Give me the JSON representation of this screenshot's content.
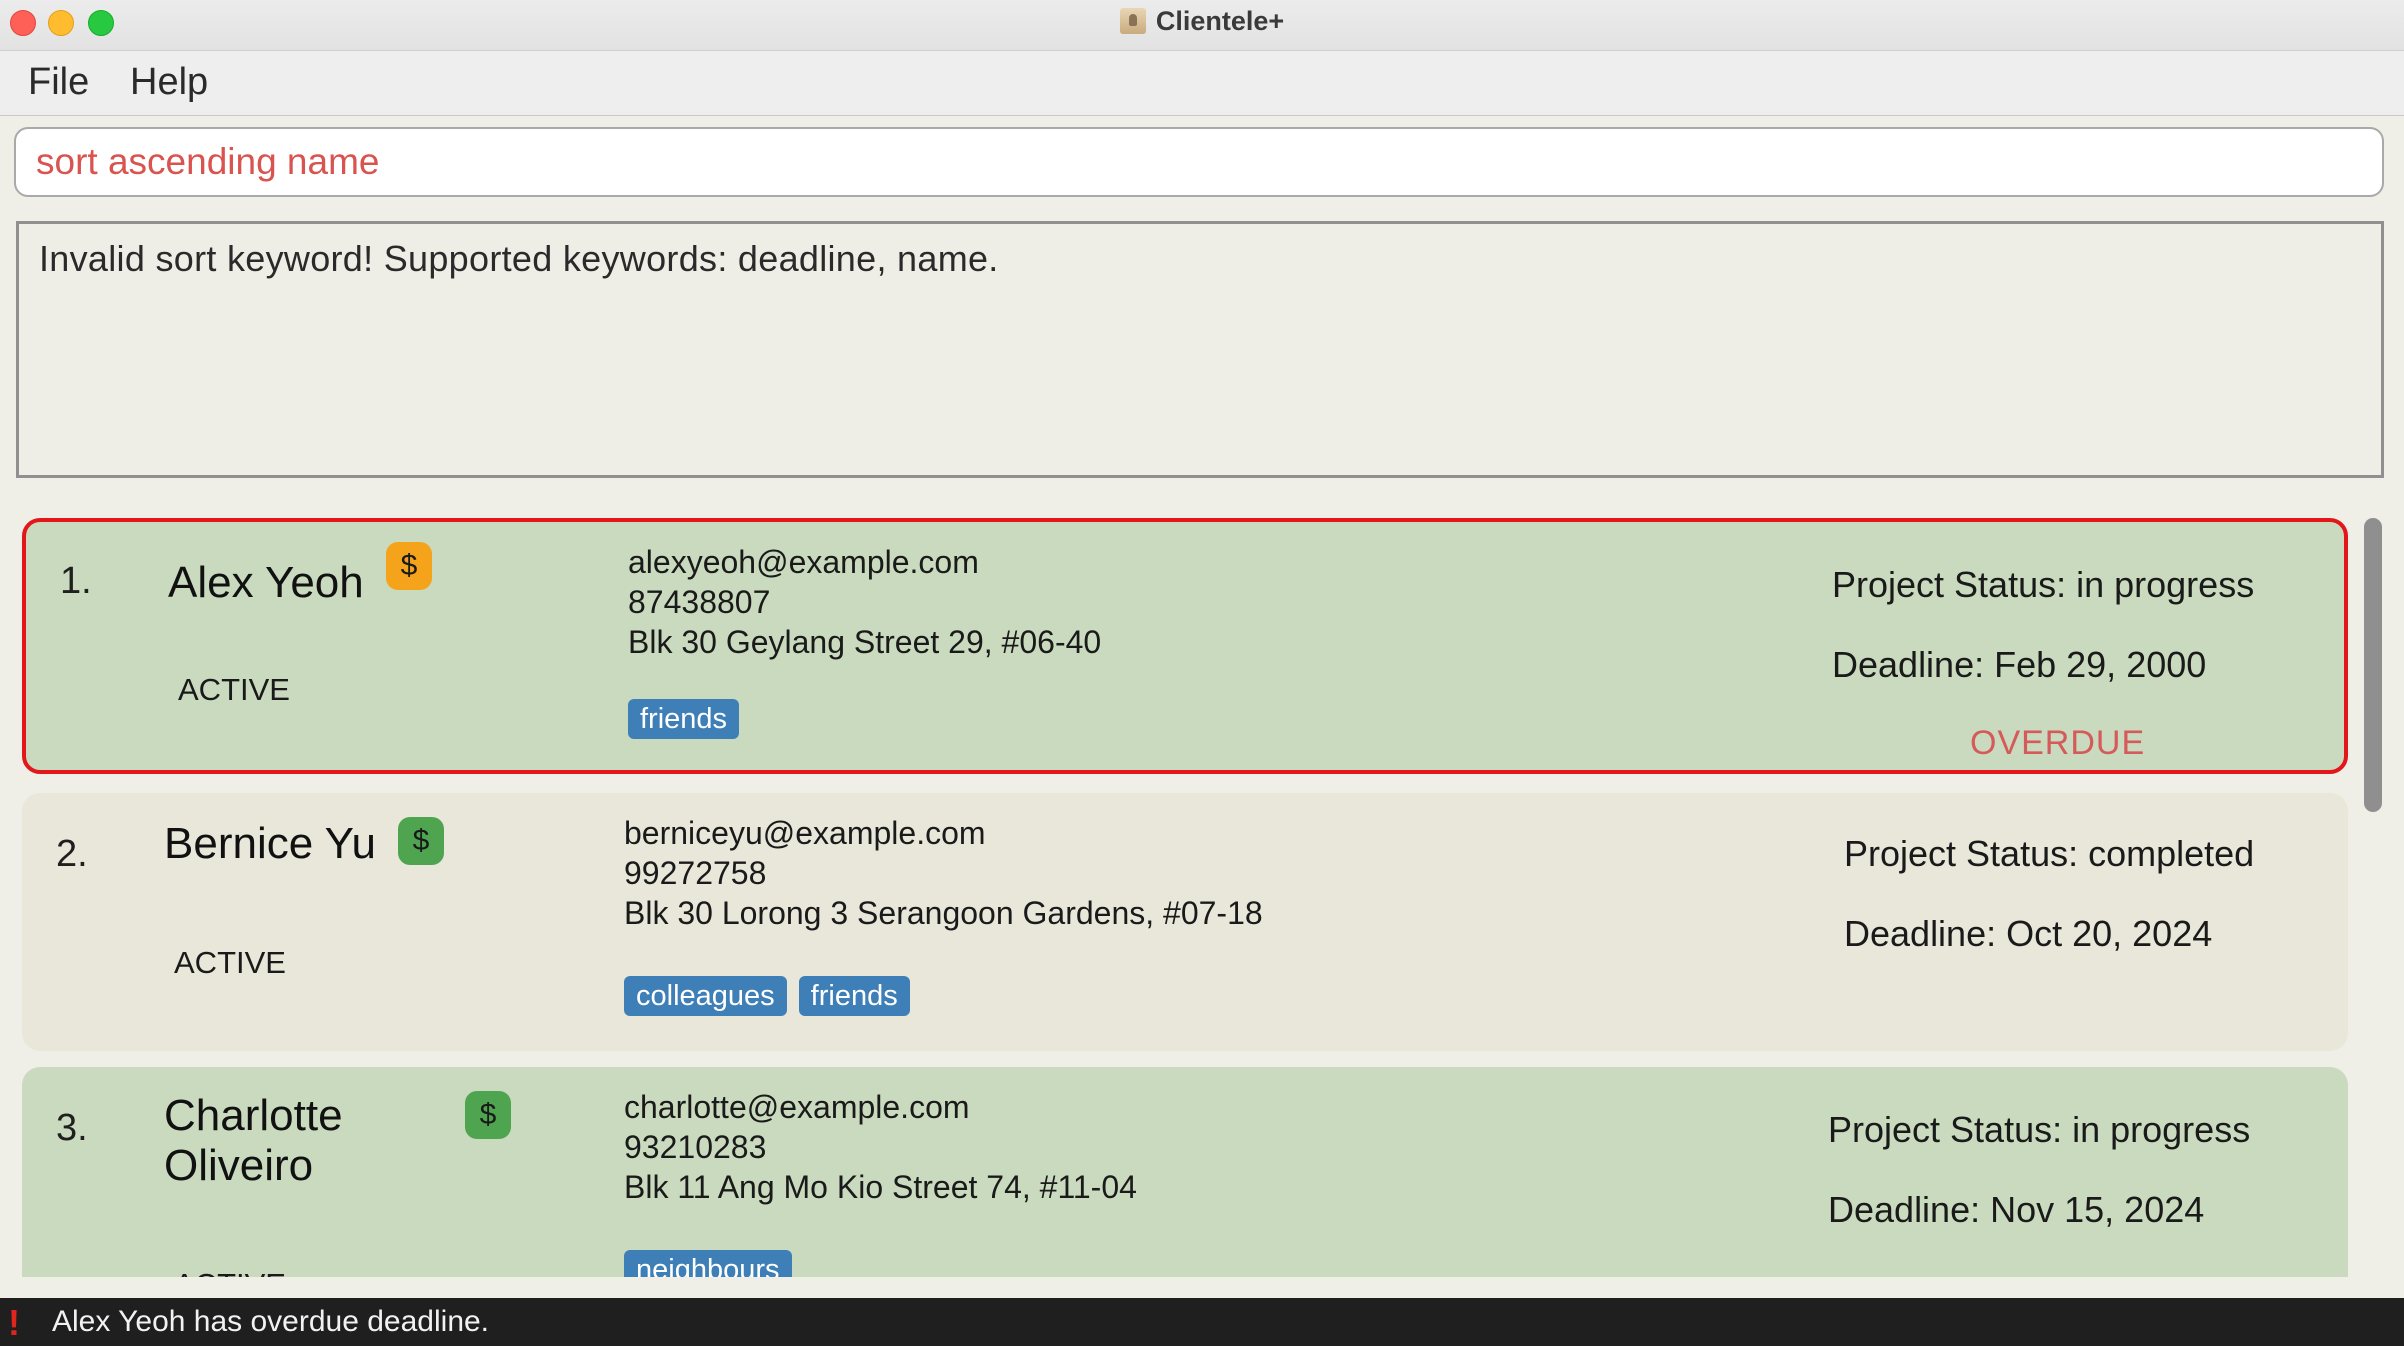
{
  "window": {
    "title": "Clientele+"
  },
  "menu": {
    "items": [
      "File",
      "Help"
    ]
  },
  "command": {
    "value": "sort ascending name"
  },
  "result": {
    "message": "Invalid sort keyword! Supported keywords: deadline, name."
  },
  "persons": [
    {
      "index": "1.",
      "name_lines": [
        "Alex Yeoh"
      ],
      "payment_icon": "$",
      "payment_color": "#f5a31a",
      "status": "ACTIVE",
      "email": "alexyeoh@example.com",
      "phone": "87438807",
      "address": "Blk 30 Geylang Street 29, #06-40",
      "tags": [
        "friends"
      ],
      "project_status": "Project Status: in progress",
      "deadline": "Deadline: Feb 29, 2000",
      "overdue": "OVERDUE"
    },
    {
      "index": "2.",
      "name_lines": [
        "Bernice Yu"
      ],
      "payment_icon": "$",
      "payment_color": "#4fa54f",
      "status": "ACTIVE",
      "email": "berniceyu@example.com",
      "phone": "99272758",
      "address": "Blk 30 Lorong 3 Serangoon Gardens, #07-18",
      "tags": [
        "colleagues",
        "friends"
      ],
      "project_status": "Project Status: completed",
      "deadline": "Deadline: Oct 20, 2024"
    },
    {
      "index": "3.",
      "name_lines": [
        "Charlotte",
        "Oliveiro"
      ],
      "payment_icon": "$",
      "payment_color": "#4fa54f",
      "status": "ACTIVE",
      "email": "charlotte@example.com",
      "phone": "93210283",
      "address": "Blk 11 Ang Mo Kio Street 74, #11-04",
      "tags": [
        "neighbours"
      ],
      "project_status": "Project Status: in progress",
      "deadline": "Deadline: Nov 15, 2024"
    }
  ],
  "status_bar": {
    "icon": "exclamation-icon",
    "message": "Alex Yeoh has overdue deadline."
  }
}
